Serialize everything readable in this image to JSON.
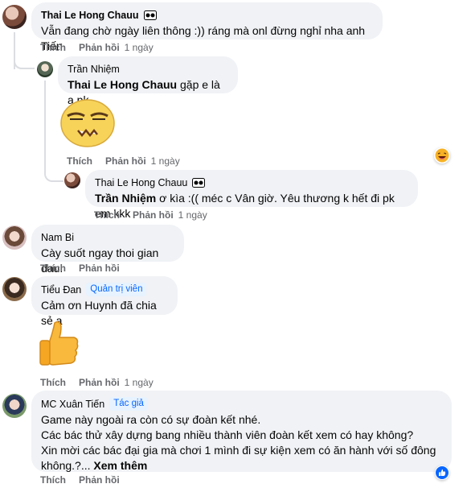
{
  "comments": [
    {
      "name": "Thai Le Hong Chauu",
      "text": "Vẫn đang chờ ngày liên thông :)) ráng mà onl đừng nghỉ nha anh Tiến",
      "time": "1 ngày"
    },
    {
      "name": "Trần Nhiệm",
      "mention": "Thai Le Hong Chauu",
      "text": " gặp e là a pk",
      "time": "1 ngày"
    },
    {
      "name": "Thai Le Hong Chauu",
      "mention": "Trần Nhiệm",
      "text": " ơ kìa :(( méc c Vân giờ. Yêu thương k hết đi pk em kkk",
      "time": "1 ngày"
    },
    {
      "name": "Nam Bi",
      "text": "Cày suốt ngay thoi gian dau!",
      "time": ""
    },
    {
      "name": "Tiểu Đan",
      "badge": "Quản trị viên",
      "text": "Cảm ơn Huynh đã chia sẻ ạ",
      "time": "1 ngày"
    },
    {
      "name": "MC Xuân Tiến",
      "badge": "Tác giả",
      "lines": [
        "Game này ngoài ra còn có sự đoàn kết nhé.",
        "Các bác thử xây dựng bang nhiều thành viên đoàn kết xem có hay không?",
        "Xin mời các bác đại gia mà chơi 1 mình đi sự kiện xem có ăn hành với số đông"
      ],
      "last_line": "không.?...",
      "see_more": "Xem thêm",
      "time": ""
    }
  ],
  "actions": {
    "like": "Thích",
    "reply": "Phản hồi"
  },
  "icons": {
    "haha": "haha-react-icon",
    "like": "like-react-icon",
    "sticker": "meh-face-sticker",
    "thumb": "thumbs-up-sticker"
  },
  "colors": {
    "bubble": "#f0f2f5",
    "meta": "#65676b",
    "link": "#0866ff"
  }
}
